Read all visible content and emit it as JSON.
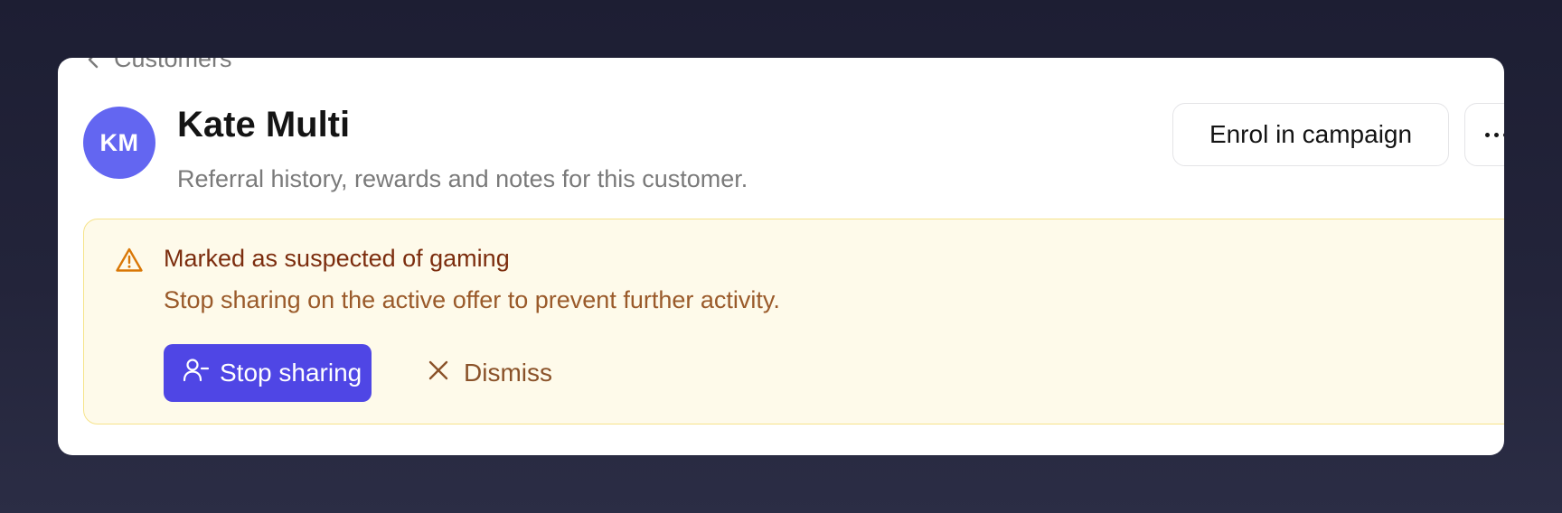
{
  "breadcrumb": {
    "label": "Customers",
    "back_icon": "chevron-left-icon"
  },
  "customer": {
    "initials": "KM",
    "name": "Kate Multi",
    "subtitle": "Referral history, rewards and notes for this customer.",
    "avatar_color": "#6366f1"
  },
  "actions": {
    "enrol_label": "Enrol in campaign",
    "more_icon": "more-horizontal-icon"
  },
  "alert": {
    "icon": "warning-triangle-icon",
    "title": "Marked as suspected of gaming",
    "description": "Stop sharing on the active offer to prevent further activity.",
    "primary_label": "Stop sharing",
    "primary_icon": "user-minus-icon",
    "secondary_label": "Dismiss",
    "secondary_icon": "close-icon",
    "colors": {
      "background": "#fefaea",
      "border": "#f6e38a",
      "title": "#7c2d0e",
      "text": "#9a5a2a",
      "icon": "#d97706",
      "primary_button": "#4f46e5"
    }
  }
}
